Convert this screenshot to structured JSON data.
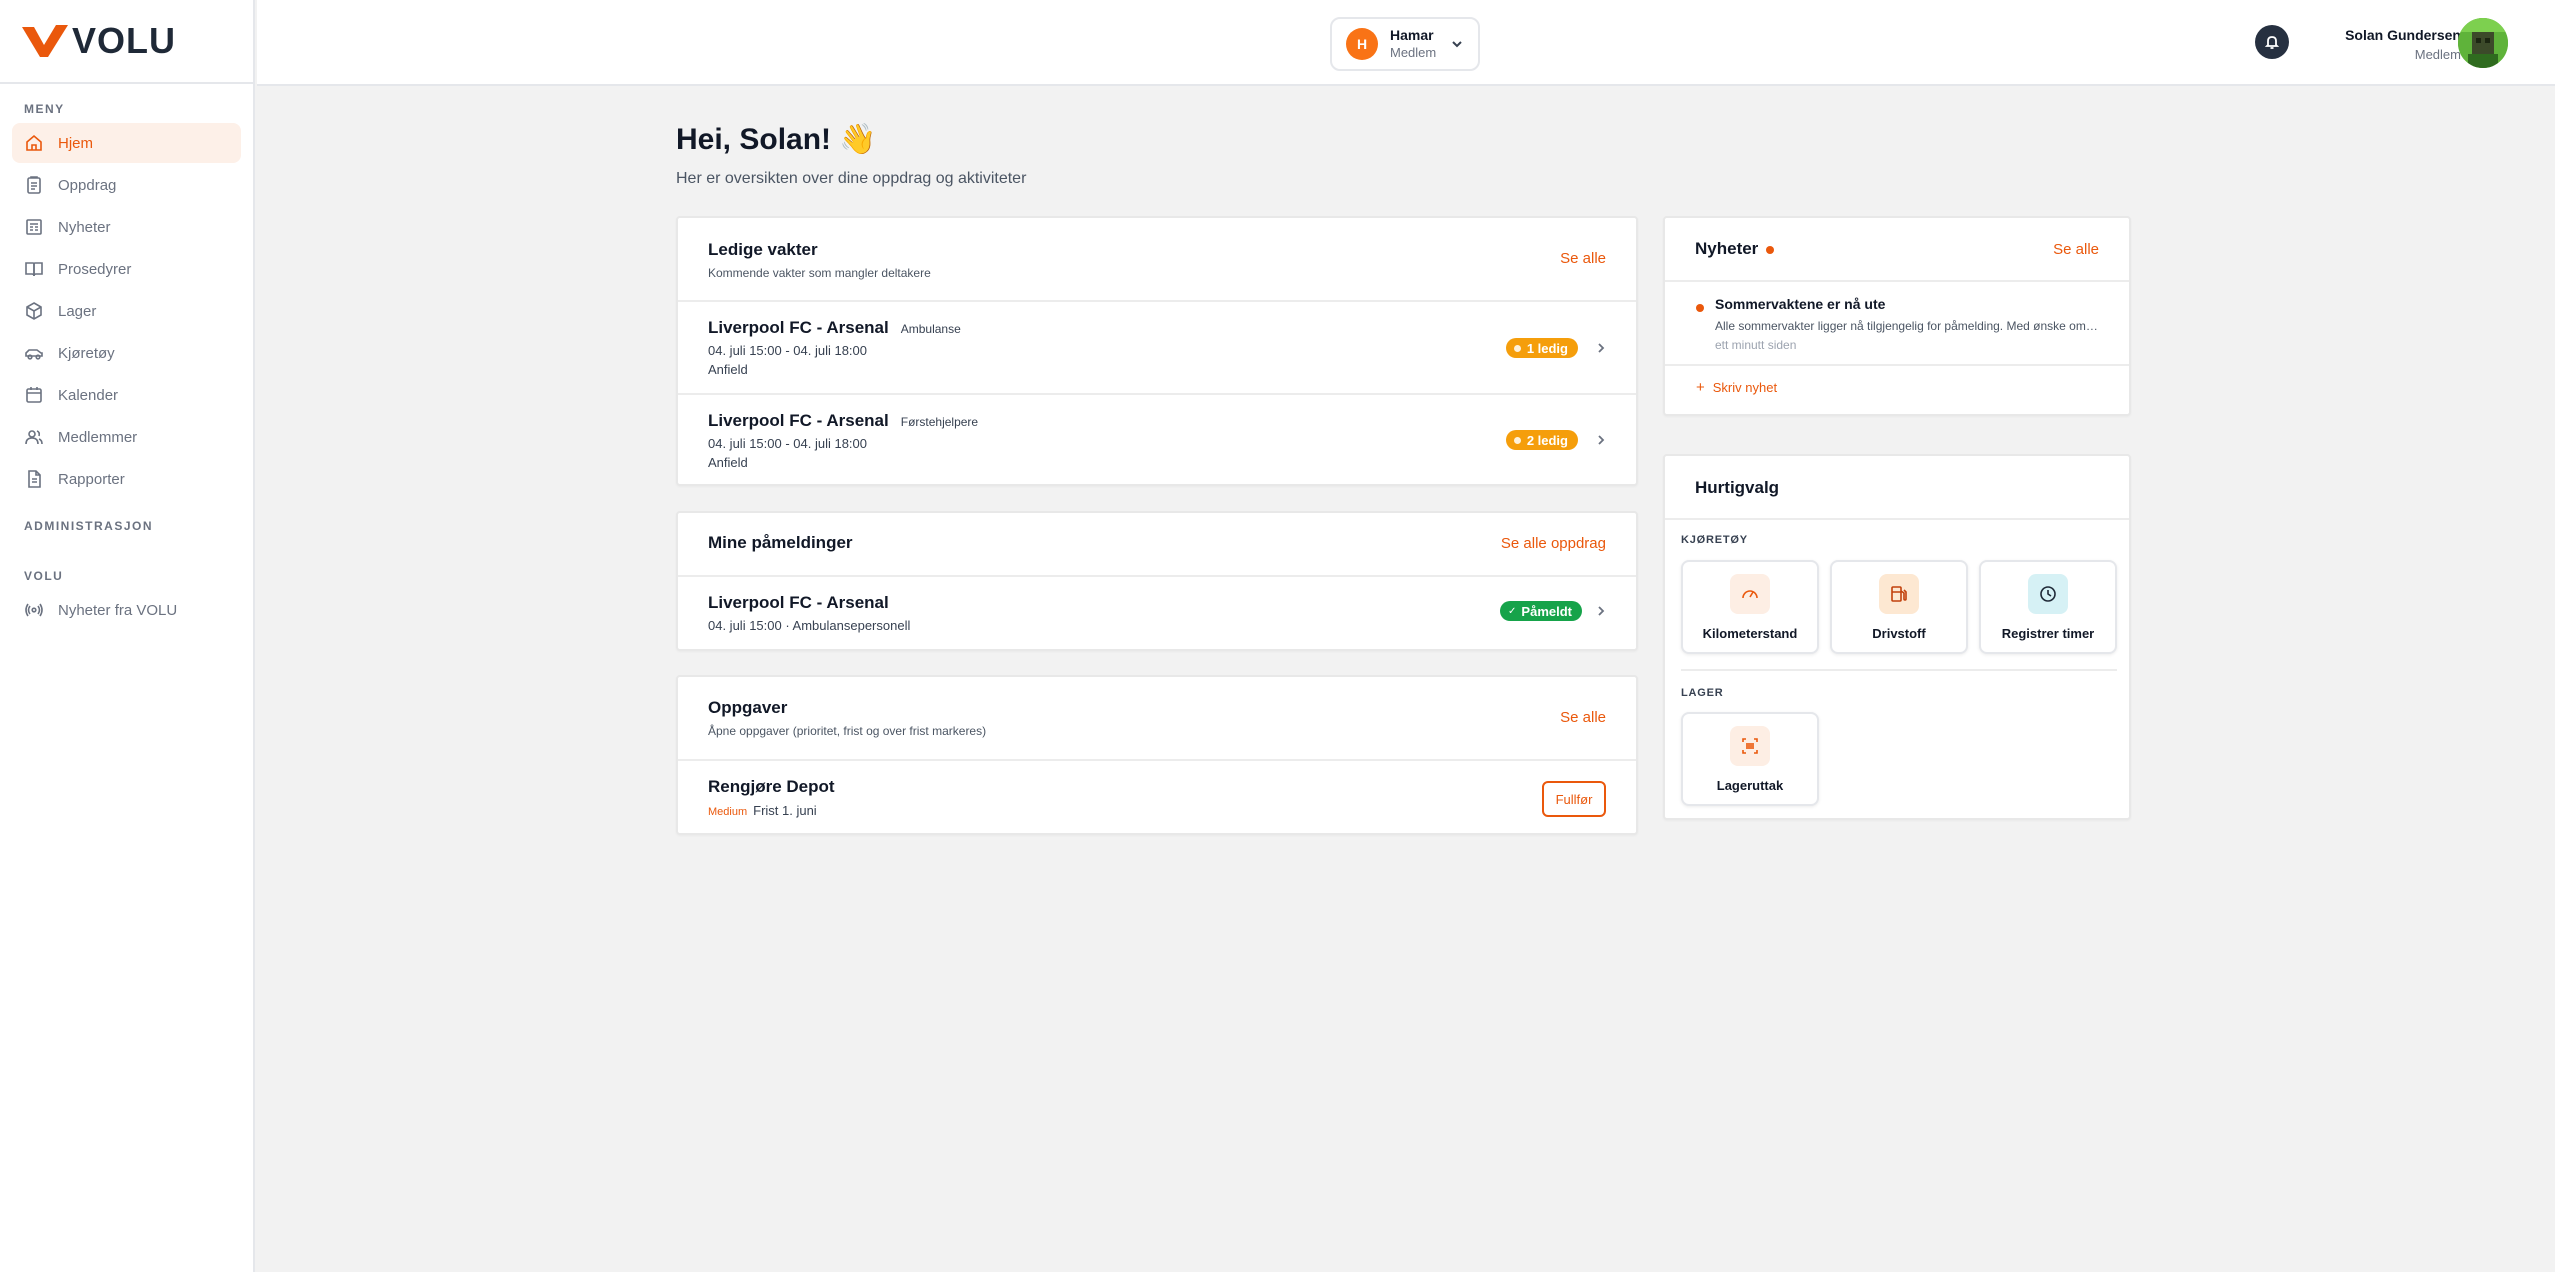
{
  "brand": {
    "name": "VOLU",
    "accent": "#ea580c"
  },
  "sidebar": {
    "section_menu": "MENY",
    "items": [
      {
        "label": "Hjem",
        "icon": "home-icon",
        "active": true
      },
      {
        "label": "Oppdrag",
        "icon": "clipboard-icon"
      },
      {
        "label": "Nyheter",
        "icon": "newspaper-icon"
      },
      {
        "label": "Prosedyrer",
        "icon": "book-icon"
      },
      {
        "label": "Lager",
        "icon": "box-icon"
      },
      {
        "label": "Kjøretøy",
        "icon": "car-icon"
      },
      {
        "label": "Kalender",
        "icon": "calendar-icon"
      },
      {
        "label": "Medlemmer",
        "icon": "users-icon"
      },
      {
        "label": "Rapporter",
        "icon": "file-icon"
      }
    ],
    "section_admin": "ADMINISTRASJON",
    "section_volu": "VOLU",
    "volu_items": [
      {
        "label": "Nyheter fra VOLU",
        "icon": "broadcast-icon"
      }
    ]
  },
  "topbar": {
    "org": {
      "initial": "H",
      "name": "Hamar",
      "role": "Medlem"
    },
    "user": {
      "name": "Solan Gundersen",
      "role": "Medlem"
    }
  },
  "greeting": {
    "title": "Hei, Solan! 👋",
    "subtitle": "Her er oversikten over dine oppdrag og aktiviteter"
  },
  "ledige_vakter": {
    "title": "Ledige vakter",
    "subtitle": "Kommende vakter som mangler deltakere",
    "link": "Se alle",
    "rows": [
      {
        "title": "Liverpool FC - Arsenal",
        "tag": "Ambulanse",
        "time": "04. juli 15:00 - 04. juli 18:00",
        "place": "Anfield",
        "badge": "1 ledig"
      },
      {
        "title": "Liverpool FC - Arsenal",
        "tag": "Førstehjelpere",
        "time": "04. juli 15:00 - 04. juli 18:00",
        "place": "Anfield",
        "badge": "2 ledig"
      }
    ]
  },
  "pameldinger": {
    "title": "Mine påmeldinger",
    "link": "Se alle oppdrag",
    "rows": [
      {
        "title": "Liverpool FC - Arsenal",
        "detail": "04. juli 15:00 · Ambulansepersonell",
        "badge": "Påmeldt"
      }
    ]
  },
  "oppgaver": {
    "title": "Oppgaver",
    "subtitle": "Åpne oppgaver (prioritet, frist og over frist markeres)",
    "link": "Se alle",
    "rows": [
      {
        "title": "Rengjøre Depot",
        "priority": "Medium",
        "deadline": "Frist 1. juni",
        "action": "Fullfør"
      }
    ]
  },
  "nyheter": {
    "title": "Nyheter",
    "link": "Se alle",
    "items": [
      {
        "title": "Sommervaktene er nå ute",
        "body": "Alle sommervakter ligger nå tilgjengelig for påmelding. Med ønske om en fin sommer",
        "when": "ett minutt siden"
      }
    ],
    "write": "Skriv nyhet"
  },
  "hurtigvalg": {
    "title": "Hurtigvalg",
    "section_vehicle": "KJØRETØY",
    "section_storage": "LAGER",
    "vehicle_tiles": [
      {
        "label": "Kilometerstand",
        "icon": "gauge-icon",
        "bg": "#fdeee4",
        "color": "#ea580c"
      },
      {
        "label": "Drivstoff",
        "icon": "fuel-icon",
        "bg": "#fde8d2",
        "color": "#c2410c"
      },
      {
        "label": "Registrer timer",
        "icon": "clock-icon",
        "bg": "#d6f1f5",
        "color": "#1f2937"
      }
    ],
    "storage_tiles": [
      {
        "label": "Lageruttak",
        "icon": "barcode-scan-icon",
        "bg": "#fdeee4",
        "color": "#ea580c"
      }
    ]
  }
}
